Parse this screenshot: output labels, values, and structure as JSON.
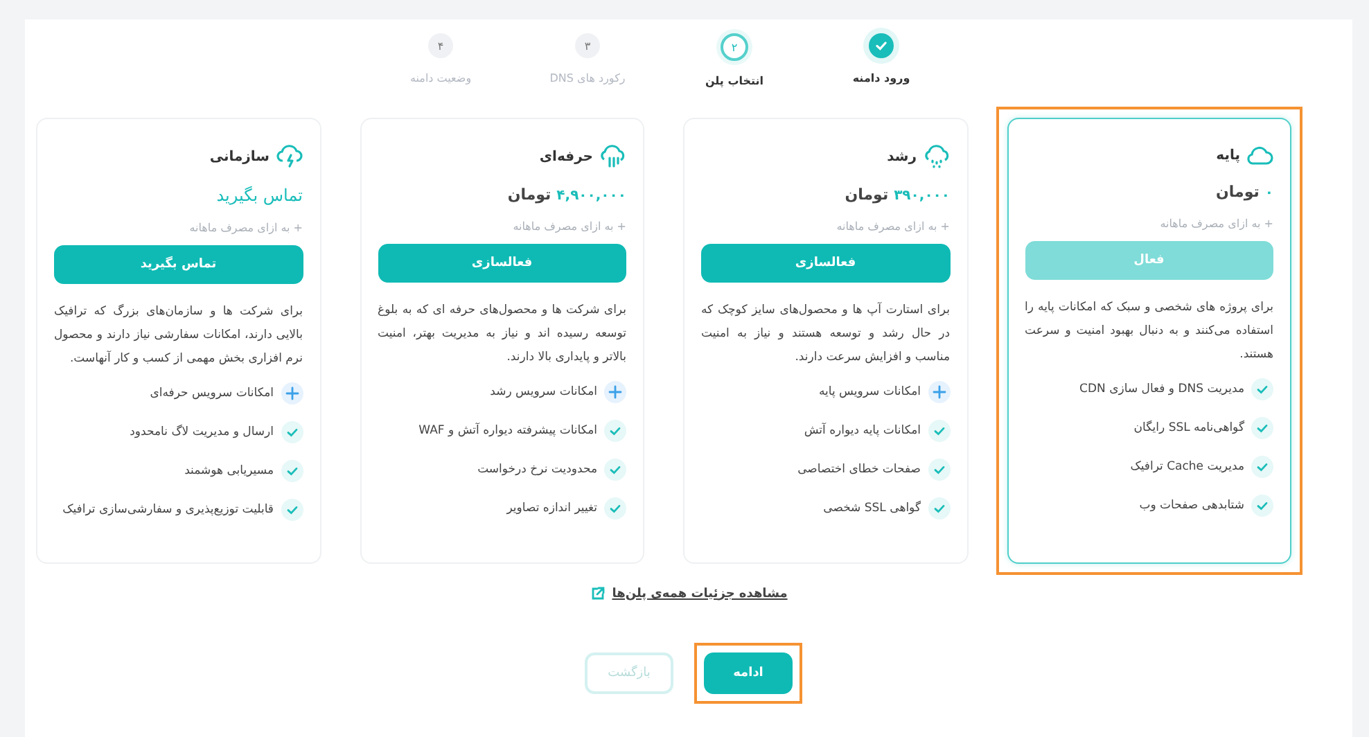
{
  "steps": [
    {
      "label": "ورود دامنه",
      "completed": true
    },
    {
      "number": "۲",
      "label": "انتخاب پلن",
      "completed": false
    },
    {
      "number": "۳",
      "label": "رکورد های DNS",
      "completed": false
    },
    {
      "number": "۴",
      "label": "وضعیت دامنه",
      "completed": false
    }
  ],
  "plans": [
    {
      "name": "پایه",
      "kind": "cloud",
      "amount": "۰",
      "unit": "تومان",
      "note": "+ به ازای مصرف ماهانه",
      "button": {
        "label": "فعال",
        "disabled": true
      },
      "selected": true,
      "description": "برای پروژه های شخصی و سبک که امکانات پایه را استفاده می‌کنند و به دنبال بهبود امنیت و سرعت هستند.",
      "features": [
        {
          "kind": "check",
          "text": "مدیریت DNS و فعال سازی CDN"
        },
        {
          "kind": "check",
          "text": "گواهی‌نامه SSL رایگان"
        },
        {
          "kind": "check",
          "text": "مدیریت Cache ترافیک"
        },
        {
          "kind": "check",
          "text": "شتابدهی صفحات وب"
        }
      ]
    },
    {
      "name": "رشد",
      "kind": "drizzle",
      "amount": "۳۹۰,۰۰۰",
      "unit": "تومان",
      "note": "+ به ازای مصرف ماهانه",
      "button": {
        "label": "فعالسازی",
        "disabled": false
      },
      "selected": false,
      "description": "برای استارت آپ ها و محصول‌های سایز کوچک که در حال رشد و توسعه هستند و نیاز به امنیت مناسب و افزایش سرعت دارند.",
      "features": [
        {
          "kind": "plus",
          "text": "امکانات سرویس پایه"
        },
        {
          "kind": "check",
          "text": "امکانات پایه دیواره آتش"
        },
        {
          "kind": "check",
          "text": "صفحات خطای اختصاصی"
        },
        {
          "kind": "check",
          "text": "گواهی SSL شخصی"
        }
      ]
    },
    {
      "name": "حرفه‌ای",
      "kind": "rain",
      "amount": "۴,۹۰۰,۰۰۰",
      "unit": "تومان",
      "note": "+ به ازای مصرف ماهانه",
      "button": {
        "label": "فعالسازی",
        "disabled": false
      },
      "selected": false,
      "description": "برای شرکت ها و محصول‌های حرفه ای که به بلوغ توسعه رسیده اند و نیاز به مدیریت بهتر، امنیت بالاتر و پایداری بالا دارند.",
      "features": [
        {
          "kind": "plus",
          "text": "امکانات سرویس رشد"
        },
        {
          "kind": "check",
          "text": "امکانات پیشرفته دیواره آتش و WAF"
        },
        {
          "kind": "check",
          "text": "محدودیت نرخ درخواست"
        },
        {
          "kind": "check",
          "text": "تغییر اندازه تصاویر"
        }
      ]
    },
    {
      "name": "سازمانی",
      "kind": "lightning",
      "amount": "تماس بگیرید",
      "note": "+ به ازای مصرف ماهانه",
      "button": {
        "label": "تماس بگیرید",
        "disabled": false
      },
      "selected": false,
      "description": "برای شرکت ها و سازمان‌های بزرگ که ترافیک بالایی دارند، امکانات سفارشی نیاز دارند و محصول نرم افزاری بخش مهمی از کسب و کار آنهاست.",
      "features": [
        {
          "kind": "plus",
          "text": "امکانات سرویس حرفه‌ای"
        },
        {
          "kind": "check",
          "text": "ارسال و مدیریت لاگ نامحدود"
        },
        {
          "kind": "check",
          "text": "مسیریابی هوشمند"
        },
        {
          "kind": "check",
          "text": "قابلیت توزیع‌پذیری و سفارشی‌سازی ترافیک"
        }
      ]
    }
  ],
  "details_link": "مشاهده جزئیات همه‌ی پلن‌ها",
  "actions": [
    {
      "label": "ادامه",
      "kind": "primary",
      "highlighted": true
    },
    {
      "label": "بازگشت",
      "kind": "secondary",
      "highlighted": false
    }
  ]
}
